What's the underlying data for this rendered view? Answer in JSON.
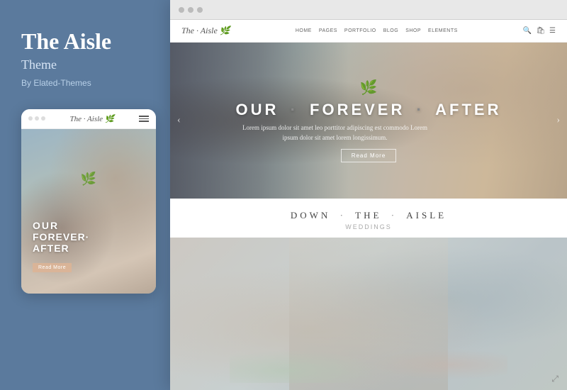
{
  "left": {
    "title": "The Aisle",
    "subtitle": "Theme",
    "author": "By Elated-Themes"
  },
  "mobile": {
    "dots": [
      "",
      "",
      ""
    ],
    "logo": "The · Aisle 🌿",
    "hero_text_line1": "OUR",
    "hero_text_line2": "FOREVER·",
    "hero_text_line3": "AFTER",
    "read_more": "Read More"
  },
  "desktop": {
    "window_dots": [
      "",
      "",
      ""
    ],
    "nav": {
      "logo": "The · Aisle 🌿",
      "links": [
        "HOME",
        "PAGES",
        "PORTFOLIO",
        "BLOG",
        "SHOP",
        "ELEMENTS"
      ]
    },
    "hero": {
      "title_part1": "OUR",
      "dot1": "·",
      "title_part2": "FOREVER",
      "dot2": "·",
      "title_part3": "AFTER",
      "subtitle": "Lorem ipsum dolor sit amet leo porttitor adipiscing est commodo\nLorem ipsum dolor sit amet lorem longissimum.",
      "read_more": "Read More"
    },
    "section": {
      "title_part1": "DOWN",
      "dot1": "·",
      "title_part2": "THE",
      "dot2": "·",
      "title_part3": "AISLE",
      "subtitle": "Weddings"
    }
  }
}
